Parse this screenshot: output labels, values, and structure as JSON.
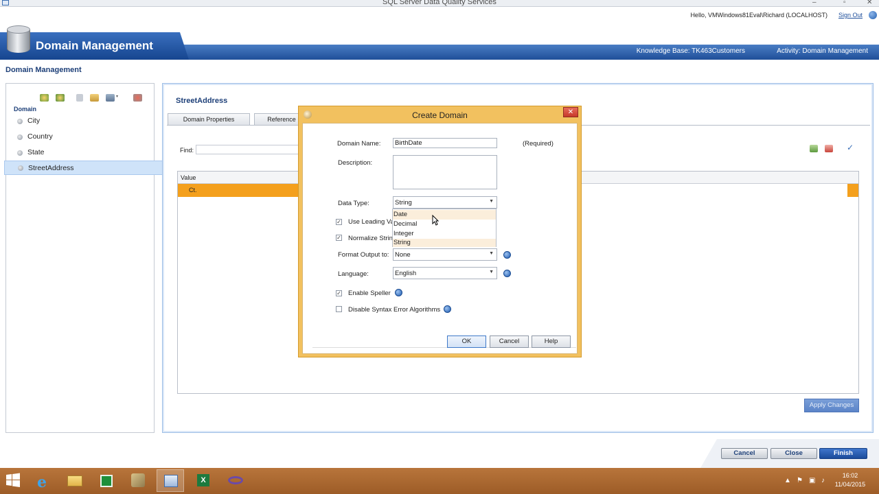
{
  "window": {
    "title": "SQL Server Data Quality Services"
  },
  "greeting": {
    "hello": "Hello, VMWindows81Eval\\Richard (LOCALHOST)",
    "sign_out": "Sign Out"
  },
  "header": {
    "title": "Domain Management",
    "knowledge_base": "Knowledge Base: TK463Customers",
    "activity": "Activity: Domain Management"
  },
  "page_title": "Domain Management",
  "left_panel": {
    "domain_label": "Domain",
    "items": [
      {
        "label": "City"
      },
      {
        "label": "Country"
      },
      {
        "label": "State"
      },
      {
        "label": "StreetAddress",
        "selected": true
      }
    ]
  },
  "right_panel": {
    "title": "StreetAddress",
    "tabs": [
      {
        "label": "Domain Properties"
      },
      {
        "label": "Reference"
      }
    ],
    "find_label": "Find:",
    "grid": {
      "header": "Value",
      "rows": [
        {
          "value": "Ct."
        }
      ]
    },
    "apply_changes": "Apply Changes"
  },
  "footer_buttons": {
    "cancel": "Cancel",
    "close": "Close",
    "finish": "Finish"
  },
  "dialog": {
    "title": "Create Domain",
    "close_glyph": "✕",
    "domain_name_label": "Domain Name:",
    "domain_name_value": "BirthDate",
    "required": "(Required)",
    "description_label": "Description:",
    "description_value": "",
    "data_type_label": "Data Type:",
    "data_type_value": "String",
    "data_type_options": [
      "Date",
      "Decimal",
      "Integer",
      "String"
    ],
    "use_leading_label": "Use Leading Val",
    "use_leading_checked": true,
    "normalize_label": "Normalize String",
    "normalize_checked": true,
    "format_output_label": "Format Output to:",
    "format_output_value": "None",
    "language_label": "Language:",
    "language_value": "English",
    "enable_speller_label": "Enable Speller",
    "enable_speller_checked": true,
    "disable_syntax_label": "Disable Syntax Error Algorithms",
    "disable_syntax_checked": false,
    "ok": "OK",
    "cancel": "Cancel",
    "help": "Help"
  },
  "taskbar": {
    "time": "16:02",
    "date": "11/04/2015"
  },
  "colors": {
    "accent_blue": "#1f4f99",
    "selection_orange": "#f4a01d",
    "dialog_frame": "#f2c15f",
    "taskbar": "#a8652d"
  }
}
